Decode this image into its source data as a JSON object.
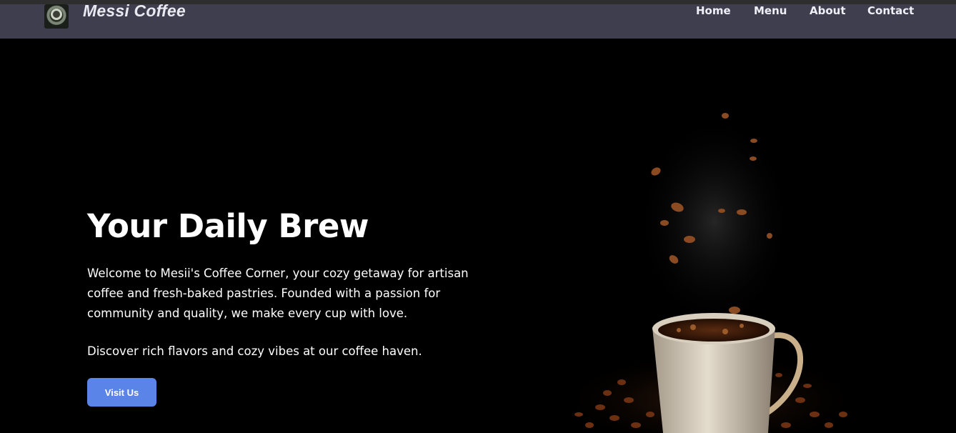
{
  "header": {
    "brand": "Messi Coffee",
    "nav": [
      "Home",
      "Menu",
      "About",
      "Contact"
    ]
  },
  "hero": {
    "title": "Your Daily Brew",
    "paragraph1": "Welcome to Mesii's Coffee Corner, your cozy getaway for artisan coffee and fresh-baked pastries. Founded with a passion for community and quality, we make every cup with love.",
    "paragraph2": "Discover rich flavors and cozy vibes at our coffee haven.",
    "button_label": "Visit Us"
  },
  "colors": {
    "navbar": "#3e3e4e",
    "background": "#000000",
    "button": "#5b84e8"
  },
  "icons": {
    "logo": "coffee-cup-logo-icon"
  }
}
